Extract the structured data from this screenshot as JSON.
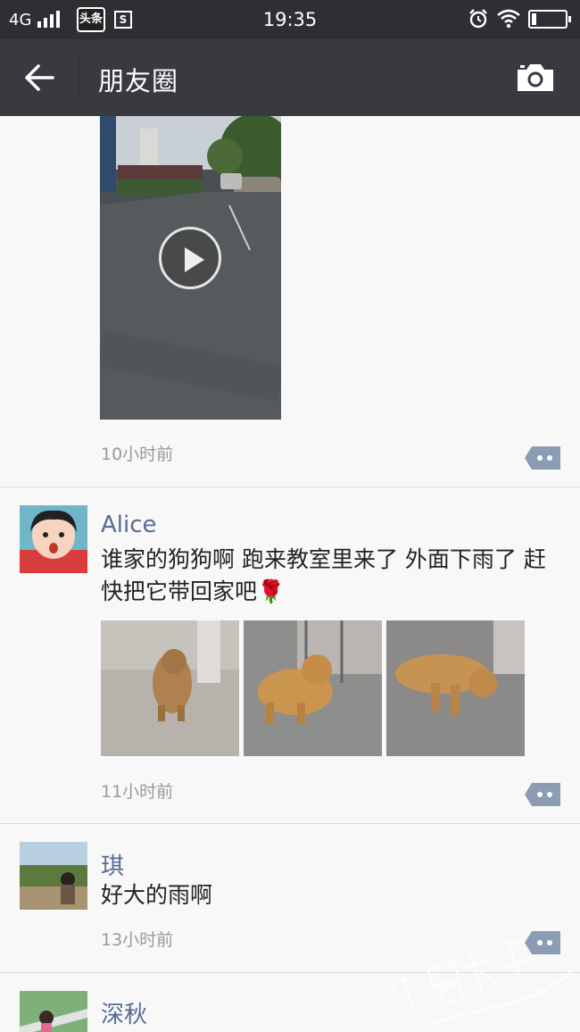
{
  "status_bar": {
    "network": "4G",
    "app_badge_1": "头条",
    "app_badge_2": "S",
    "time": "19:35"
  },
  "nav": {
    "title": "朋友圈"
  },
  "posts": [
    {
      "timestamp": "10小时前"
    },
    {
      "username": "Alice",
      "text": "谁家的狗狗啊 跑来教室里来了 外面下雨了 赶快把它带回家吧",
      "emoji": "🌹",
      "timestamp": "11小时前"
    },
    {
      "username": "琪",
      "text": "好大的雨啊",
      "timestamp": "13小时前"
    },
    {
      "username": "深秋"
    }
  ],
  "icons": {
    "back": "arrow-left-icon",
    "camera": "camera-icon",
    "comment": "comment-dots-icon",
    "play": "play-icon"
  },
  "colors": {
    "statusbar_bg": "#2e2f33",
    "navbar_bg": "#393a3f",
    "username": "#576b95",
    "timestamp": "#9a9a9a",
    "feed_bg": "#f8f8f8",
    "comment_btn": "#8d9cb5"
  }
}
